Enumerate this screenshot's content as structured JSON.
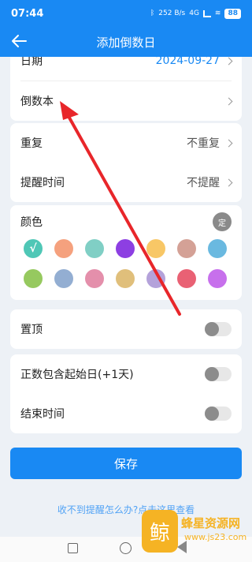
{
  "status_bar": {
    "time": "07:44",
    "net_speed": "252 B/s",
    "network": "4G",
    "battery": "88"
  },
  "header": {
    "title": "添加倒数日"
  },
  "rows": {
    "date": {
      "label": "日期",
      "value": "2024-09-27"
    },
    "book": {
      "label": "倒数本"
    },
    "repeat": {
      "label": "重复",
      "value": "不重复"
    },
    "reminder": {
      "label": "提醒时间",
      "value": "不提醒"
    },
    "pin": {
      "label": "置顶",
      "on": false
    },
    "include_start": {
      "label": "正数包含起始日(+1天)",
      "on": false
    },
    "end_time": {
      "label": "结束时间",
      "on": false
    }
  },
  "colors": {
    "label": "颜色",
    "custom_label": "定",
    "selected_mark": "√",
    "swatches": [
      {
        "color": "#4fc7b6",
        "selected": true
      },
      {
        "color": "#f5a17e"
      },
      {
        "color": "#80cfc5"
      },
      {
        "color": "#8d3fe2"
      },
      {
        "color": "#f8c766"
      },
      {
        "color": "#d4a196"
      },
      {
        "color": "#6ab9e0"
      },
      {
        "color": "#96c95f"
      },
      {
        "color": "#93aed2"
      },
      {
        "color": "#e48fab"
      },
      {
        "color": "#e0bf7b"
      },
      {
        "color": "#b4a2da"
      },
      {
        "color": "#e96174"
      },
      {
        "color": "#c770ec"
      }
    ]
  },
  "save_label": "保存",
  "help_link": "收不到提醒怎么办?点击这里查看",
  "watermark": {
    "title": "蜂星资源网",
    "url": "www.js23.com",
    "logo_glyph": "鲸"
  },
  "accent": "#1989f3",
  "annotation_color": "#e8262a"
}
